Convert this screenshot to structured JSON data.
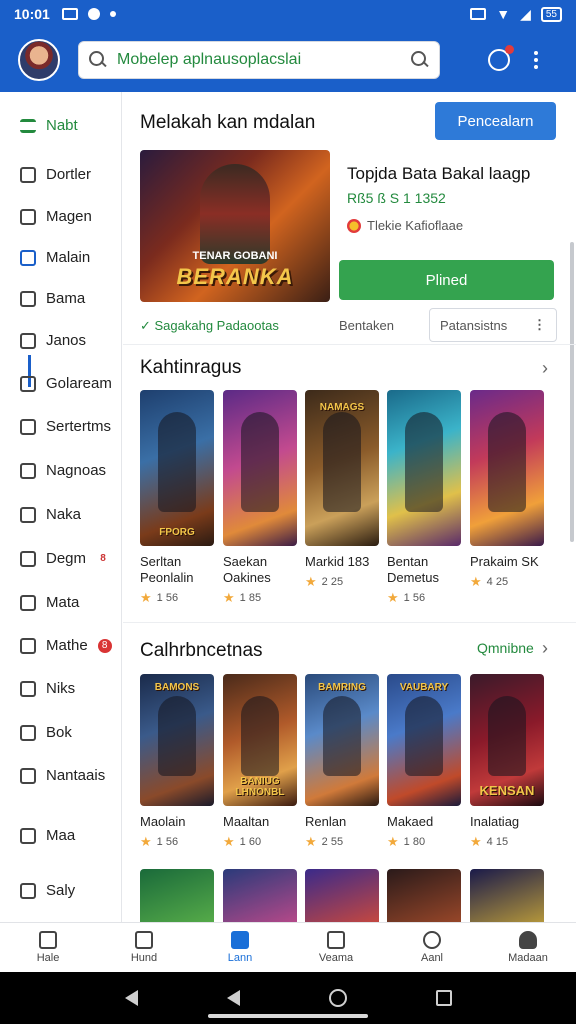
{
  "status_bar": {
    "time": "10:01",
    "battery": "55"
  },
  "search": {
    "value": "Mobelep aplnausoplacslai"
  },
  "sidebar": {
    "items": [
      {
        "label": "Nabt",
        "icon": "menu-icon",
        "active": true
      },
      {
        "label": "Dortler",
        "icon": "document-icon"
      },
      {
        "label": "Magen",
        "icon": "tag-icon"
      },
      {
        "label": "Malain",
        "icon": "bookmark-icon"
      },
      {
        "label": "Bama",
        "icon": "image-icon"
      },
      {
        "label": "Janos",
        "icon": "shield-icon"
      },
      {
        "label": "Golaream",
        "icon": "grid-icon"
      },
      {
        "label": "Sertertms",
        "icon": "folder-icon"
      },
      {
        "label": "Nagnoas",
        "icon": "chart-icon"
      },
      {
        "label": "Naka",
        "icon": "chat-icon"
      },
      {
        "label": "Degm",
        "icon": "edit-icon",
        "badge": "8"
      },
      {
        "label": "Mata",
        "icon": "flag-icon"
      },
      {
        "label": "Mathe",
        "icon": "pencil-icon",
        "badge": "8"
      },
      {
        "label": "Niks",
        "icon": "link-icon"
      },
      {
        "label": "Bok",
        "icon": "book-icon"
      },
      {
        "label": "Nantaais",
        "icon": "settings-icon"
      },
      {
        "label": "Maa",
        "icon": "mail-icon"
      },
      {
        "label": "Saly",
        "icon": "info-icon"
      }
    ]
  },
  "main": {
    "section_title": "Melakah kan mdalan",
    "primary_button": "Pencealarn",
    "featured": {
      "art_title": "BERANKA",
      "art_subtitle": "TENAR GOBANI",
      "title": "Topjda Bata Bakal laagp",
      "subtitle": "Rß5 ß S 1 1352",
      "developer": "Tlekie Kafioflaae",
      "install_label": "Plined",
      "meta_left": "✓ Sagakahg Padaootas",
      "meta_mid": "Bentaken",
      "select_value": "Patansistns"
    },
    "section2": {
      "title": "Kahtinragus",
      "cards": [
        {
          "name": "Serltan Peonlalin",
          "rating": "1 56",
          "caption": "FPORG"
        },
        {
          "name": "Saekan Oakines",
          "rating": "1 85",
          "caption": ""
        },
        {
          "name": "Markid 183",
          "rating": "2 25",
          "caption": "NAMAGS"
        },
        {
          "name": "Bentan Demetus",
          "rating": "1 56",
          "caption": ""
        },
        {
          "name": "Prakaim SK",
          "rating": "4 25",
          "caption": ""
        }
      ]
    },
    "section3": {
      "title": "Calhrbncetnas",
      "see_all": "Qmnibne",
      "cards": [
        {
          "name": "Maolain",
          "rating": "1 56",
          "caption": "BAMONS"
        },
        {
          "name": "Maaltan",
          "rating": "1 60",
          "caption": "BANIUG LHNONBL"
        },
        {
          "name": "Renlan",
          "rating": "2 55",
          "caption": "BAMRING"
        },
        {
          "name": "Makaed",
          "rating": "1 80",
          "caption": "VAUBARY"
        },
        {
          "name": "Inalatiag",
          "rating": "4 15",
          "caption": "KENSAN"
        }
      ]
    }
  },
  "bottom_nav": [
    {
      "label": "Hale",
      "icon": "home-icon"
    },
    {
      "label": "Hund",
      "icon": "apps-icon"
    },
    {
      "label": "Lann",
      "icon": "store-icon",
      "active": true
    },
    {
      "label": "Veama",
      "icon": "library-icon"
    },
    {
      "label": "Aanl",
      "icon": "chat-bubble-icon"
    },
    {
      "label": "Madaan",
      "icon": "profile-icon"
    }
  ],
  "colors": {
    "brand_blue": "#1a5fc9",
    "install_green": "#34a34f",
    "accent_green": "#238a3e",
    "active_nav": "#1a6fd8",
    "star": "#f2a93b"
  }
}
